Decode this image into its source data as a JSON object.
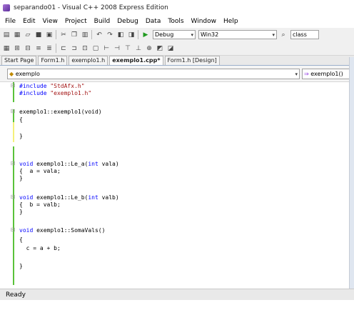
{
  "window": {
    "title": "separando01 - Visual C++ 2008 Express Edition"
  },
  "menu": [
    "File",
    "Edit",
    "View",
    "Project",
    "Build",
    "Debug",
    "Data",
    "Tools",
    "Window",
    "Help"
  ],
  "toolbar1": {
    "config": "Debug",
    "platform": "Win32",
    "find": "class"
  },
  "tabs": [
    "Start Page",
    "Form1.h",
    "exemplo1.h",
    "exemplo1.cpp*",
    "Form1.h [Design]"
  ],
  "nav": {
    "scope": "exemplo",
    "member": "exemplo1()"
  },
  "code": [
    "#include \"StdAfx.h\"",
    "#include \"exemplo1.h\"",
    "",
    "exemplo1::exemplo1(void)",
    "{",
    "",
    "}",
    "",
    "",
    "void exemplo1::Le_a(int vala)",
    "{  a = vala;",
    "}",
    "",
    "void exemplo1::Le_b(int valb)",
    "{  b = valb;",
    "}",
    "",
    "void exemplo1::SomaVals()",
    "{",
    "  c = a + b;",
    "",
    "}"
  ],
  "status": "Ready"
}
